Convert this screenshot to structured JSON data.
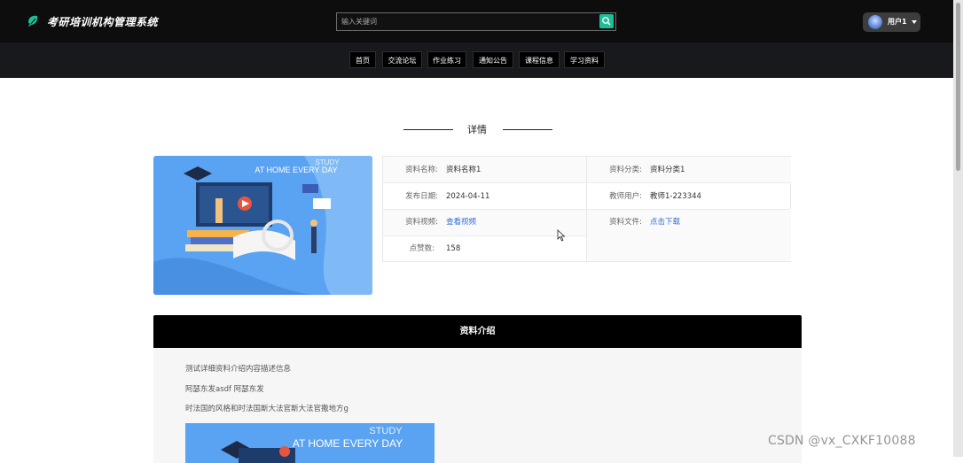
{
  "header": {
    "app_title": "考研培训机构管理系统",
    "search_placeholder": "输入关键词",
    "user_name": "用户1",
    "logo_icon": "leaf-icon",
    "search_icon": "search-icon",
    "accent_color": "#1bbf9a"
  },
  "nav": {
    "items": [
      {
        "label": "首页"
      },
      {
        "label": "交流论坛"
      },
      {
        "label": "作业练习"
      },
      {
        "label": "通知公告"
      },
      {
        "label": "课程信息"
      },
      {
        "label": "学习资料"
      }
    ]
  },
  "detail": {
    "section_title": "详情",
    "cover_text_1": "STUDY",
    "cover_text_2": "AT HOME EVERY DAY",
    "fields": {
      "name_label": "资料名称:",
      "name_value": "资料名称1",
      "category_label": "资料分类:",
      "category_value": "资料分类1",
      "date_label": "发布日期:",
      "date_value": "2024-04-11",
      "teacher_label": "教师用户:",
      "teacher_value": "教师1-223344",
      "video_label": "资料视频:",
      "video_value": "查看视频",
      "file_label": "资料文件:",
      "file_value": "点击下载",
      "likes_label": "点赞数:",
      "likes_value": "158"
    }
  },
  "intro": {
    "header": "资料介绍",
    "lines": [
      "测试详细资料介绍内容描述信息",
      "阿瑟东发asdf 阿瑟东发",
      "时法国的风格和时法国斯大法官斯大法官撒地方g"
    ],
    "image_text_1": "STUDY",
    "image_text_2": "AT HOME EVERY DAY"
  },
  "watermark": "CSDN @vx_CXKF10088"
}
